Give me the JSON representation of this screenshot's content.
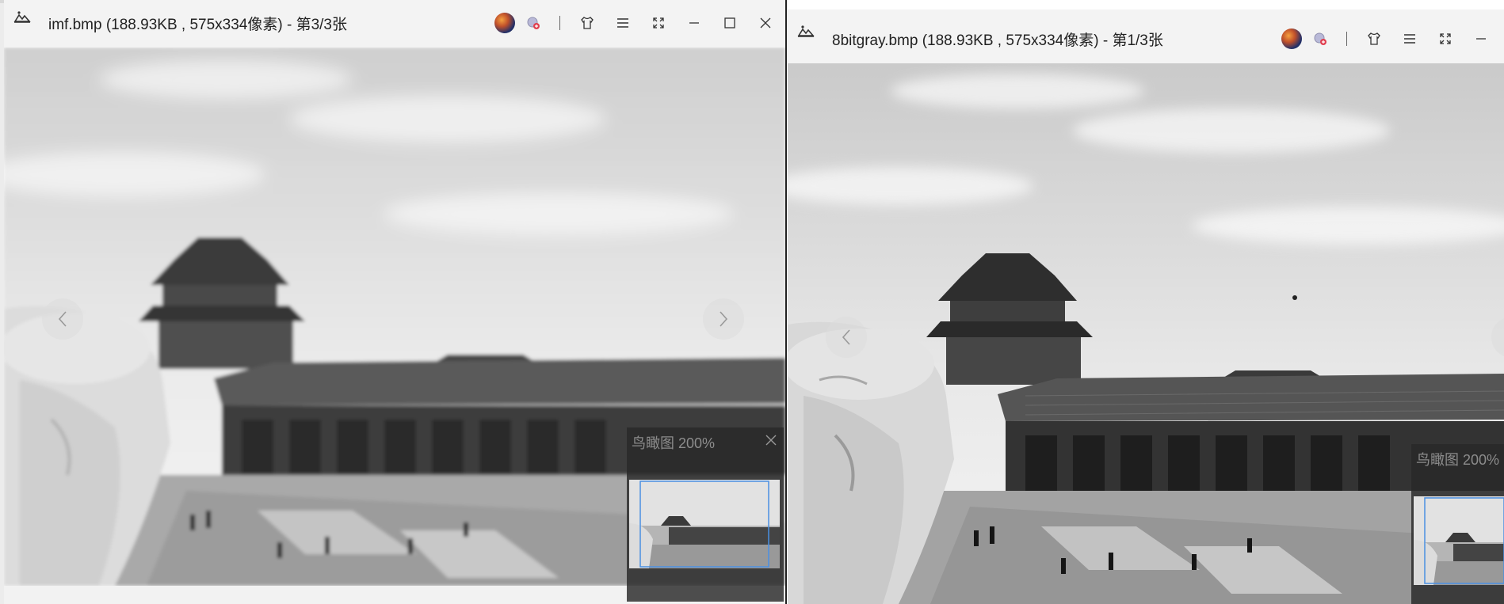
{
  "windows": [
    {
      "title": "imf.bmp (188.93KB , 575x334像素) - 第3/3张",
      "controls": [
        "avatar-icon",
        "sticker-icon",
        "skin-icon",
        "menu-icon",
        "fullscreen-icon",
        "minimize-icon",
        "maximize-icon",
        "close-icon"
      ],
      "birdseye_label": "鸟瞰图 200%",
      "image_mode": "blurred"
    },
    {
      "title": "8bitgray.bmp (188.93KB , 575x334像素) - 第1/3张",
      "controls": [
        "avatar-icon",
        "sticker-icon",
        "skin-icon",
        "menu-icon",
        "fullscreen-icon",
        "minimize-icon"
      ],
      "birdseye_label": "鸟瞰图 200%",
      "image_mode": "sharp"
    }
  ],
  "colors": {
    "titlebar": "#f3f3f3",
    "birdseye_bg": "#282828",
    "viewport_outline": "#4a90e2"
  }
}
